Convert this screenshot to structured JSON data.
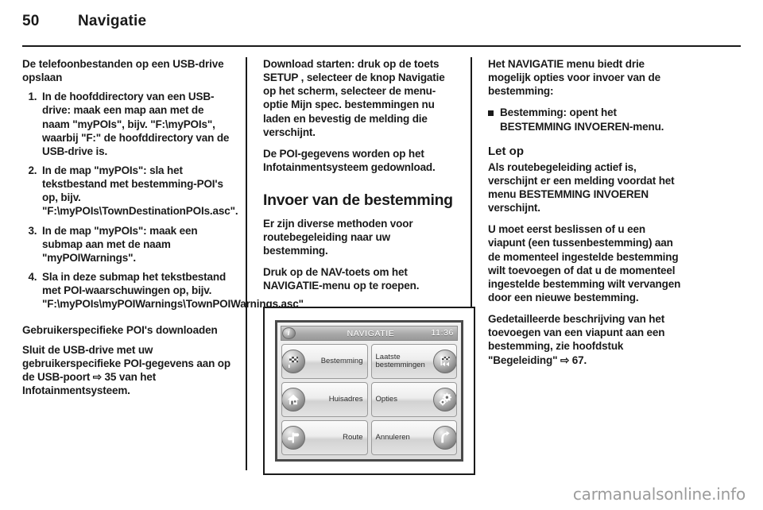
{
  "header": {
    "page_number": "50",
    "chapter_title": "Navigatie"
  },
  "left_column": {
    "heading": "De telefoonbestanden op een USB-drive opslaan",
    "steps": [
      "In de hoofddirectory van een USB-drive: maak een map aan met de naam \"myPOIs\", bijv. \"F:\\myPOIs\", waarbij \"F:\" de hoofddirectory van de USB-drive is.",
      "In de map \"myPOIs\": sla het tekstbestand met bestemming-POI's op, bijv. \"F:\\myPOIs\\TownDestinationPOIs.asc\".",
      "In de map \"myPOIs\": maak een submap aan met de naam \"myPOIWarnings\".",
      "Sla in deze submap het tekstbestand met POI-waarschuwingen op, bijv. \"F:\\myPOIs\\myPOIWarnings\\TownPOIWarnings.asc\""
    ],
    "heading2": "Gebruikerspecifieke POI's downloaden",
    "paragraph2": "Sluit de USB-drive met uw gebruikerspecifieke POI-gegevens aan op de USB-poort ⇨ 35 van het Infotainmentsysteem."
  },
  "mid_column": {
    "paragraph1": "Download starten: druk op de toets SETUP , selecteer de knop Navigatie op het scherm, selecteer de menu-optie Mijn spec. bestemmingen nu laden en bevestig de melding die verschijnt.",
    "paragraph2": "De POI-gegevens worden op het Infotainmentsysteem gedownload.",
    "heading": "Invoer van de bestemming",
    "paragraph3": "Er zijn diverse methoden voor routebegeleiding naar uw bestemming.",
    "paragraph4": "Druk op de NAV-toets om het NAVIGATIE-menu op te roepen."
  },
  "nav_screen": {
    "info_icon": "info-icon",
    "title": "NAVIGATIE",
    "clock": "11:36",
    "buttons": [
      {
        "label": "Bestemming",
        "icon": "checkered-flag-icon",
        "icon_side": "left"
      },
      {
        "label": "Laatste bestemmingen",
        "icon": "flag-rewind-icon",
        "icon_side": "right"
      },
      {
        "label": "Huisadres",
        "icon": "home-icon",
        "icon_side": "left"
      },
      {
        "label": "Opties",
        "icon": "gears-icon",
        "icon_side": "right"
      },
      {
        "label": "Route",
        "icon": "signpost-icon",
        "icon_side": "left"
      },
      {
        "label": "Annuleren",
        "icon": "turn-arrow-icon",
        "icon_side": "right"
      }
    ]
  },
  "right_column": {
    "paragraph1": "Het NAVIGATIE menu biedt drie mogelijk opties voor invoer van de bestemming:",
    "bullets": [
      "Bestemming: opent het BESTEMMING INVOEREN-menu."
    ],
    "note_title": "Let op",
    "note_body": "Als routebegeleiding actief is, verschijnt er een melding voordat het menu BESTEMMING INVOEREN verschijnt.",
    "paragraph2": "U moet eerst beslissen of u een viapunt (een tussenbestemming) aan de momenteel ingestelde bestemming wilt toevoegen of dat u de momenteel ingestelde bestemming wilt vervangen door een nieuwe bestemming.",
    "paragraph3": "Gedetailleerde beschrijving van het toevoegen van een viapunt aan een bestemming, zie hoofdstuk \"Begeleiding\" ⇨ 67."
  },
  "watermark": {
    "text": "carmanualsonline.info"
  },
  "colors": {
    "text": "#1a1a1a",
    "watermark": "#9b9b9b",
    "rule": "#1a1a1a"
  }
}
